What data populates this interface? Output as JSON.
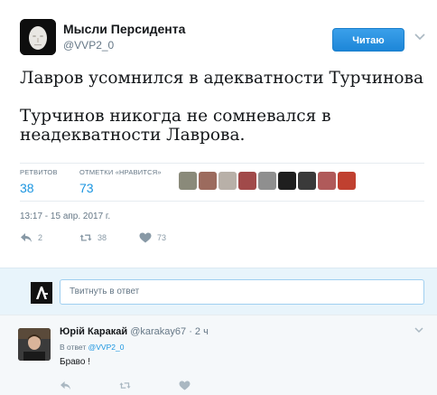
{
  "tweet": {
    "author_name": "Мысли Персидента",
    "author_handle": "@VVP2_0",
    "follow_label": "Читаю",
    "text_lines": [
      "Лавров усомнился в адекватности Турчинова",
      "Турчинов никогда не сомневался в неадекватности Лаврова."
    ],
    "retweets_label": "РЕТВИТОВ",
    "retweets_count": "38",
    "likes_label": "ОТМЕТКИ «НРАВИТСЯ»",
    "likes_count": "73",
    "liker_colors": [
      "#8a8a7a",
      "#9c6b5e",
      "#b8b0a8",
      "#a14a4a",
      "#8f8f8f",
      "#1f1f1f",
      "#3a3a3a",
      "#b05a5a",
      "#c04030"
    ],
    "timestamp": "13:17 - 15 апр. 2017 г.",
    "actions": {
      "reply_count": "2",
      "retweet_count": "38",
      "like_count": "73"
    },
    "icons": [
      "reply-icon",
      "retweet-icon",
      "heart-icon",
      "chevron-down-icon"
    ]
  },
  "reply_box": {
    "placeholder": "Твитнуть в ответ"
  },
  "reply": {
    "author_name": "Юрій Каракай",
    "author_handle": "@karakay67",
    "time": "· 2 ч",
    "replying_to_prefix": "В ответ",
    "replying_to_handle": "@VVP2_0",
    "text": "Браво !"
  },
  "colors": {
    "accent": "#1b95e0",
    "follow_button": "#2a91e3",
    "muted": "#657786",
    "reply_bar_bg": "#e8f4fb"
  }
}
